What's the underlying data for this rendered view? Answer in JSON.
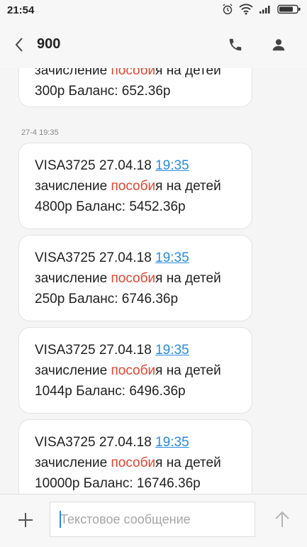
{
  "status": {
    "time": "21:54",
    "icons": [
      "alarm-icon",
      "wifi-icon",
      "signal-icon",
      "battery-icon"
    ]
  },
  "header": {
    "title": "900",
    "back_icon": "back-arrow-icon",
    "call_icon": "phone-icon",
    "contact_icon": "contact-icon"
  },
  "messages": [
    {
      "line2a": "зачисление ",
      "hl": "пособи",
      "line2b": "я на детей",
      "line3": "300р Баланс: 652.36р"
    },
    {
      "date_label": "27-4 19:35"
    },
    {
      "prefix": "VISA3725 27.04.18 ",
      "time": "19:35",
      "line2a": "зачисление ",
      "hl": "пособи",
      "line2b": "я на детей",
      "line3": "4800р Баланс: 5452.36р"
    },
    {
      "prefix": "VISA3725 27.04.18 ",
      "time": "19:35",
      "line2a": "зачисление ",
      "hl": "пособи",
      "line2b": "я на детей",
      "line3": "250р Баланс: 6746.36р"
    },
    {
      "prefix": "VISA3725 27.04.18 ",
      "time": "19:35",
      "line2a": "зачисление ",
      "hl": "пособи",
      "line2b": "я на детей",
      "line3": "1044р Баланс: 6496.36р"
    },
    {
      "prefix": "VISA3725 27.04.18 ",
      "time": "19:35",
      "line2a": "зачисление ",
      "hl": "пособи",
      "line2b": "я на детей",
      "line3": "10000р Баланс: 16746.36р"
    }
  ],
  "composer": {
    "placeholder": "Текстовое сообщение",
    "add_icon": "plus-icon",
    "send_icon": "send-arrow-icon"
  },
  "colors": {
    "link": "#2a8ae0",
    "highlight": "#e2442f",
    "background": "#f5f5f5"
  }
}
